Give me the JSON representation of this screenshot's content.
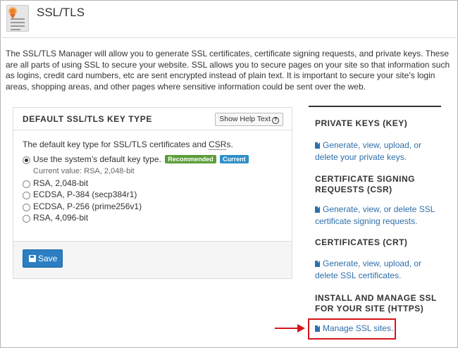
{
  "header": {
    "title": "SSL/TLS",
    "icon": "certificate-icon"
  },
  "intro": "The SSL/TLS Manager will allow you to generate SSL certificates, certificate signing requests, and private keys. These are all parts of using SSL to secure your website. SSL allows you to secure pages on your site so that information such as logins, credit card numbers, etc are sent encrypted instead of plain text. It is important to secure your site’s login areas, shopping areas, and other pages where sensitive information could be sent over the web.",
  "panel": {
    "title": "DEFAULT SSL/TLS KEY TYPE",
    "help_button": "Show Help Text",
    "description_prefix": "The default key type for SSL/TLS certificates and ",
    "description_abbr": "CSR",
    "description_suffix": "s.",
    "options": [
      {
        "label": "Use the system’s default key type.",
        "checked": true
      },
      {
        "label": "RSA, 2,048-bit",
        "checked": false
      },
      {
        "label": "ECDSA, P-384 (secp384r1)",
        "checked": false
      },
      {
        "label": "ECDSA, P-256 (prime256v1)",
        "checked": false
      },
      {
        "label": "RSA, 4,096-bit",
        "checked": false
      }
    ],
    "badges": {
      "recommended": "Recommended",
      "current": "Current"
    },
    "current_value": "Current value: RSA, 2,048-bit",
    "save_label": "Save"
  },
  "sidebar": {
    "private_keys": {
      "heading": "PRIVATE KEYS (KEY)",
      "link_line1": "Generate, view, upload, or",
      "link_line2": "delete your private keys."
    },
    "csr": {
      "heading_line1": "CERTIFICATE SIGNING",
      "heading_line2": "REQUESTS (CSR)",
      "link_line1": "Generate, view, or delete SSL",
      "link_line2": "certificate signing requests."
    },
    "crt": {
      "heading": "CERTIFICATES (CRT)",
      "link_line1": "Generate, view, upload, or",
      "link_line2": "delete SSL certificates."
    },
    "install": {
      "heading_line1": "INSTALL AND MANAGE SSL",
      "heading_line2": "FOR YOUR SITE (HTTPS)",
      "link": "Manage SSL sites."
    }
  },
  "colors": {
    "link": "#2f6fab",
    "save_button": "#2b7ec1",
    "recommended_badge": "#5b9c3a",
    "current_badge": "#2f8fc9",
    "annotation": "#d7141a"
  }
}
